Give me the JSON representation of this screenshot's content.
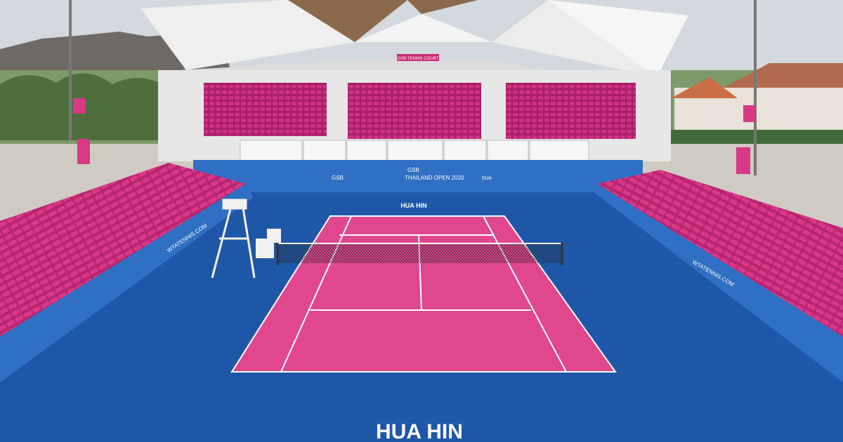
{
  "stand_sign": "GSB TENNIS COURT",
  "court_text_far": "HUA HIN",
  "court_text_near": "HUA HIN",
  "board_sponsors": [
    "GSB",
    "GSB",
    "THAILAND OPEN 2020",
    "true"
  ],
  "side_wall_left": "WTATENNIS.COM",
  "side_wall_right": "WTATENNIS.COM",
  "colors": {
    "court_pink": "#e0478e",
    "surround_blue": "#1f57a8",
    "seat_magenta": "#c92a78",
    "line_white": "#ffffff",
    "sky": "#d3d9de"
  }
}
